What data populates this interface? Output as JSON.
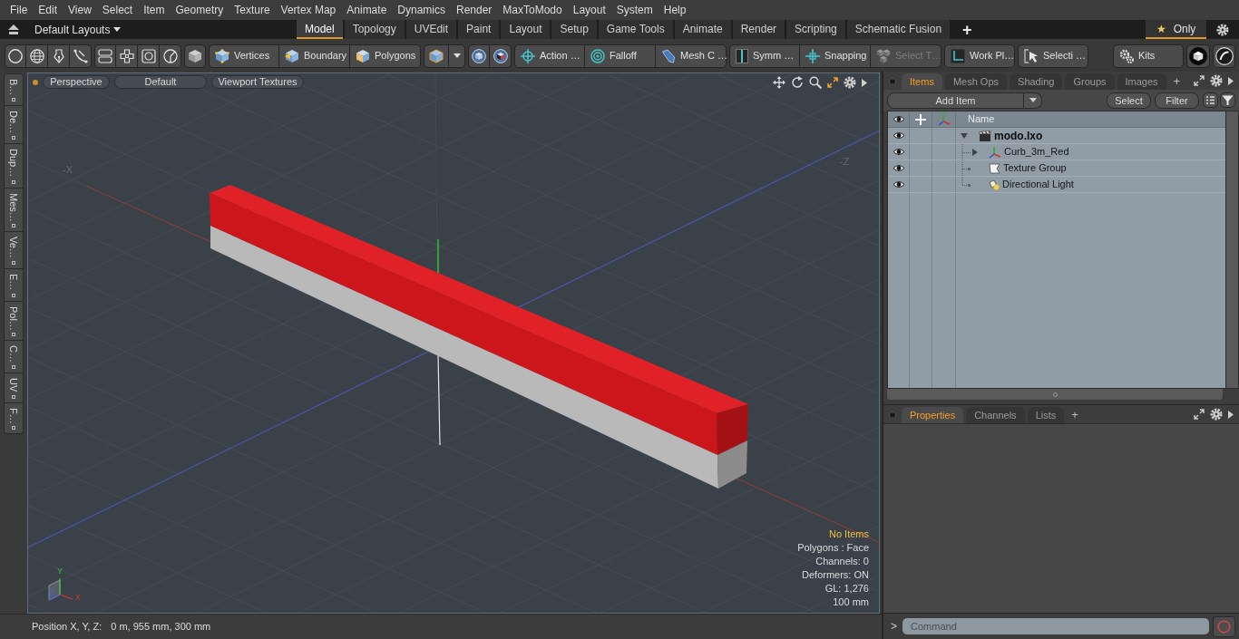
{
  "menu_bar": {
    "items": [
      "File",
      "Edit",
      "View",
      "Select",
      "Item",
      "Geometry",
      "Texture",
      "Vertex Map",
      "Animate",
      "Dynamics",
      "Render",
      "MaxToModo",
      "Layout",
      "System",
      "Help"
    ]
  },
  "layout_bar": {
    "layouts": "Default Layouts",
    "tabs": [
      {
        "label": "Model",
        "selected": true
      },
      {
        "label": "Topology",
        "selected": false
      },
      {
        "label": "UVEdit",
        "selected": false
      },
      {
        "label": "Paint",
        "selected": false
      },
      {
        "label": "Layout",
        "selected": false
      },
      {
        "label": "Setup",
        "selected": false
      },
      {
        "label": "Game Tools",
        "selected": false
      },
      {
        "label": "Animate",
        "selected": false
      },
      {
        "label": "Render",
        "selected": false
      },
      {
        "label": "Scripting",
        "selected": false
      },
      {
        "label": "Schematic Fusion",
        "selected": false
      }
    ],
    "add_tab": "+",
    "favorites": {
      "star": "★",
      "label": "Only",
      "selected": true
    }
  },
  "toolbar": {
    "buttons": [
      {
        "label": "Vertices",
        "disabled": false
      },
      {
        "label": "Boundary",
        "disabled": false
      },
      {
        "label": "Polygons",
        "disabled": false
      },
      {
        "label": "Action …",
        "disabled": false
      },
      {
        "label": "Falloff",
        "disabled": false
      },
      {
        "label": "Mesh C …",
        "disabled": false
      },
      {
        "label": "Symm …",
        "disabled": false
      },
      {
        "label": "Snapping",
        "disabled": false
      },
      {
        "label": "Select T…",
        "disabled": true
      },
      {
        "label": "Work Pl…",
        "disabled": false
      },
      {
        "label": "Selecti …",
        "disabled": false
      },
      {
        "label": "Kits",
        "disabled": false
      }
    ]
  },
  "side_toolbar": {
    "tabs": [
      "B…",
      "De…",
      "Dup…",
      "Mes…",
      "Ve…",
      "E…",
      "Pol…",
      "C…",
      "UV",
      "F…"
    ]
  },
  "viewport": {
    "buttons": [
      "Perspective",
      "Default",
      "Viewport Textures"
    ],
    "axis_labels": [
      "-X",
      "-Z"
    ],
    "info": [
      {
        "text": "No Items",
        "highlighted": true
      },
      {
        "text": "Polygons : Face",
        "highlighted": false
      },
      {
        "text": "Channels: 0",
        "highlighted": false
      },
      {
        "text": "Deformers: ON",
        "highlighted": false
      },
      {
        "text": "GL: 1,276",
        "highlighted": false
      },
      {
        "text": "100 mm",
        "highlighted": false
      }
    ],
    "gizmo_labels": [
      "Y",
      "X",
      "Z"
    ]
  },
  "status_bar": {
    "label": "Position X, Y, Z:",
    "value": "0 m, 955 mm, 300 mm"
  },
  "items_panel": {
    "tabs": [
      {
        "label": "Items",
        "selected": true
      },
      {
        "label": "Mesh Ops",
        "selected": false
      },
      {
        "label": "Shading",
        "selected": false
      },
      {
        "label": "Groups",
        "selected": false
      },
      {
        "label": "Images",
        "selected": false
      }
    ],
    "add_tab": "+",
    "add_item": "Add Item",
    "buttons": [
      "Select",
      "Filter"
    ],
    "columns": {
      "name": "Name"
    },
    "tree": [
      {
        "name": "modo.lxo",
        "kind": "scene",
        "visible": true,
        "expanded": true,
        "children": [
          {
            "name": "Curb_3m_Red",
            "kind": "mesh",
            "visible": true,
            "expanded": false
          },
          {
            "name": "Texture Group",
            "kind": "texture_group",
            "visible": true
          },
          {
            "name": "Directional Light",
            "kind": "light",
            "visible": true
          }
        ]
      }
    ]
  },
  "properties_panel": {
    "tabs": [
      {
        "label": "Properties",
        "selected": true
      },
      {
        "label": "Channels",
        "selected": false
      },
      {
        "label": "Lists",
        "selected": false
      }
    ],
    "add_tab": "+"
  },
  "command_bar": {
    "prompt": ">",
    "placeholder": "Command"
  }
}
